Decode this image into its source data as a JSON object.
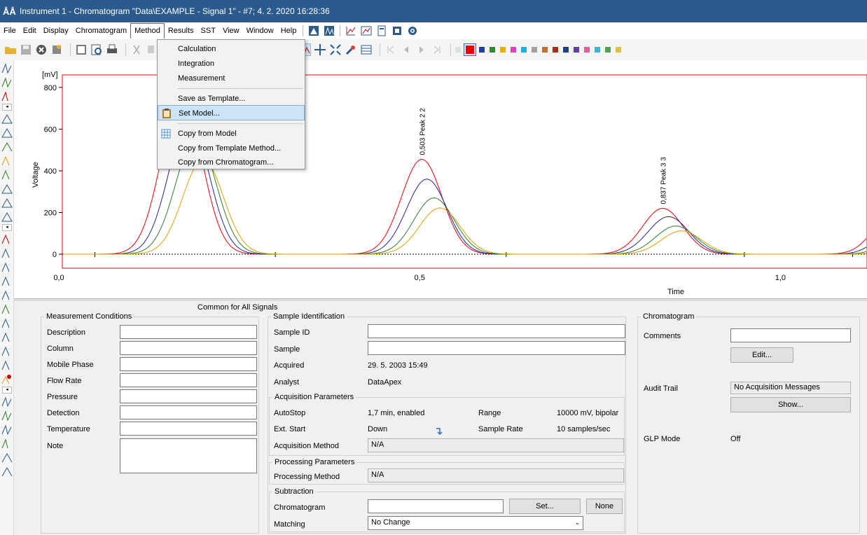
{
  "window": {
    "title": "Instrument 1 - Chromatogram \"Data\\EXAMPLE - Signal 1\" - #7;  4. 2. 2020  16:28:36"
  },
  "menu": {
    "items": [
      "File",
      "Edit",
      "Display",
      "Chromatogram",
      "Method",
      "Results",
      "SST",
      "View",
      "Window",
      "Help"
    ]
  },
  "method_menu": {
    "items": [
      "Calculation",
      "Integration",
      "Measurement",
      "Save as Template...",
      "Set Model...",
      "Copy from Model",
      "Copy from Template Method...",
      "Copy from Chromatogram..."
    ]
  },
  "colors": {
    "accent_title": "#2b5a8c",
    "trace_red": "#e8000b",
    "trace_blue": "#2222aa",
    "trace_green": "#2e7d2e",
    "trace_orange": "#e0a000",
    "swatches": [
      "#e0e0e0",
      "#e8000b",
      "#1f3fa8",
      "#2e8b2e",
      "#e0b000",
      "#e040c0",
      "#20b0e0",
      "#a0a0a0",
      "#c07030",
      "#a03020",
      "#204080",
      "#6040a0",
      "#e060a0",
      "#40b0d0",
      "#50a050",
      "#e0c040"
    ]
  },
  "chart_data": {
    "type": "line",
    "ylabel": "Voltage",
    "yunit": "[mV]",
    "xlabel": "Time",
    "xlim": [
      0.0,
      1.12
    ],
    "ylim": [
      -60,
      860
    ],
    "yticks": [
      0,
      200,
      400,
      600,
      800
    ],
    "xticks": [
      "0,0",
      "0,5",
      "1,0"
    ],
    "xtick_values": [
      0.0,
      0.5,
      1.0
    ],
    "series": [
      {
        "color": "red",
        "peaks": [
          {
            "x": 0.17,
            "h": 760,
            "w": 0.028
          },
          {
            "x": 0.503,
            "h": 455,
            "w": 0.028
          },
          {
            "x": 0.837,
            "h": 220,
            "w": 0.028
          },
          {
            "x": 1.16,
            "h": 220,
            "w": 0.028
          }
        ]
      },
      {
        "color": "blue",
        "peaks": [
          {
            "x": 0.18,
            "h": 640,
            "w": 0.028
          },
          {
            "x": 0.51,
            "h": 360,
            "w": 0.028
          },
          {
            "x": 0.845,
            "h": 180,
            "w": 0.028
          },
          {
            "x": 1.17,
            "h": 180,
            "w": 0.028
          }
        ]
      },
      {
        "color": "green",
        "peaks": [
          {
            "x": 0.19,
            "h": 560,
            "w": 0.028
          },
          {
            "x": 0.52,
            "h": 270,
            "w": 0.028
          },
          {
            "x": 0.855,
            "h": 135,
            "w": 0.028
          },
          {
            "x": 1.18,
            "h": 135,
            "w": 0.028
          }
        ]
      },
      {
        "color": "orange",
        "peaks": [
          {
            "x": 0.2,
            "h": 455,
            "w": 0.028
          },
          {
            "x": 0.528,
            "h": 222,
            "w": 0.028
          },
          {
            "x": 0.863,
            "h": 112,
            "w": 0.028
          },
          {
            "x": 1.19,
            "h": 112,
            "w": 0.028
          }
        ]
      }
    ],
    "annotations": [
      {
        "x": 0.503,
        "y": 455,
        "text": "0,503 Peak 2  2"
      },
      {
        "x": 0.837,
        "y": 220,
        "text": "0,837 Peak 3  3"
      }
    ]
  },
  "bottom": {
    "common_label": "Common for All Signals",
    "measurement": {
      "title": "Measurement Conditions",
      "fields": [
        "Description",
        "Column",
        "Mobile Phase",
        "Flow Rate",
        "Pressure",
        "Detection",
        "Temperature",
        "Note"
      ]
    },
    "sample": {
      "title": "Sample Identification",
      "sample_id_label": "Sample ID",
      "sample_label": "Sample",
      "acquired_label": "Acquired",
      "acquired_value": "29. 5. 2003  15:49",
      "analyst_label": "Analyst",
      "analyst_value": "DataApex"
    },
    "acquisition": {
      "title": "Acquisition Parameters",
      "autostop_label": "AutoStop",
      "autostop_value": "1,7 min, enabled",
      "range_label": "Range",
      "range_value": "10000 mV, bipolar",
      "extstart_label": "Ext. Start",
      "extstart_value": "Down",
      "samplerate_label": "Sample Rate",
      "samplerate_value": "10 samples/sec",
      "method_label": "Acquisition Method",
      "method_value": "N/A"
    },
    "processing": {
      "title": "Processing Parameters",
      "method_label": "Processing Method",
      "method_value": "N/A"
    },
    "subtraction": {
      "title": "Subtraction",
      "chrom_label": "Chromatogram",
      "set_button": "Set...",
      "none_button": "None",
      "matching_label": "Matching",
      "matching_value": "No Change"
    },
    "chromatogram": {
      "title": "Chromatogram",
      "comments_label": "Comments",
      "edit_button": "Edit...",
      "audit_label": "Audit Trail",
      "audit_value": "No Acquisition Messages",
      "show_button": "Show...",
      "glp_label": "GLP Mode",
      "glp_value": "Off"
    }
  }
}
